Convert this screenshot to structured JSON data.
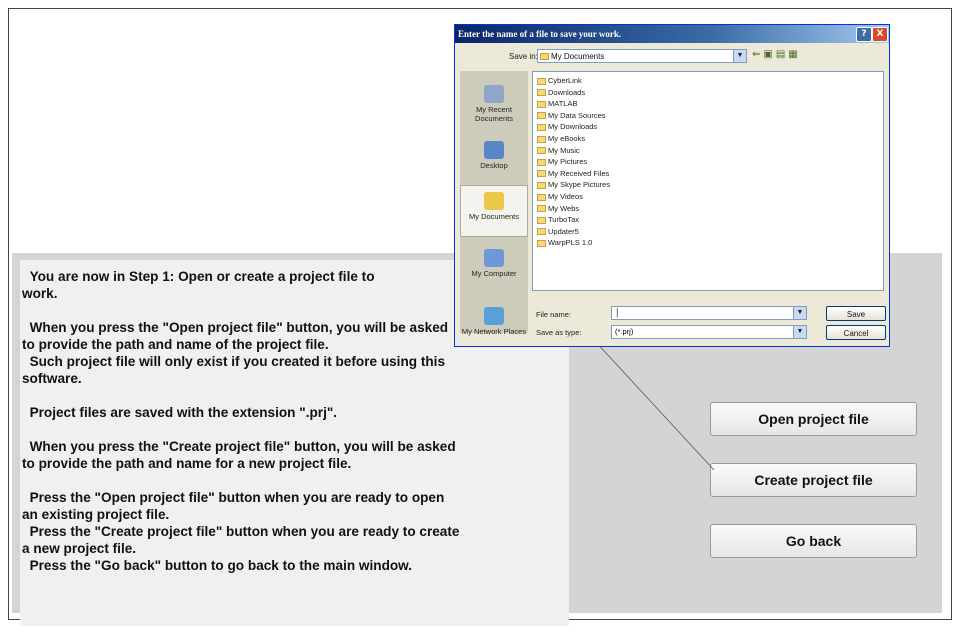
{
  "instructions": {
    "lines": [
      "  You are now in Step 1: Open or create a project file to",
      "work.",
      "",
      "  When you press the \"Open project file\" button, you will be asked",
      "to provide the path and name of the project file.",
      "  Such project file will only exist if you created it before using this",
      "software.",
      "",
      "  Project files are saved with the extension \".prj\".",
      "",
      "  When you press the \"Create project file\" button, you will be asked",
      "to provide the path and name for a new project file.",
      "",
      "  Press the \"Open project file\" button when you are ready to open",
      "an existing project file.",
      "  Press the \"Create project file\" button when you are ready to create",
      "a new project file.",
      "  Press the \"Go back\" button to go back to the main window."
    ]
  },
  "buttons": {
    "open": "Open project file",
    "create": "Create project file",
    "back": "Go back"
  },
  "dialog": {
    "title": "Enter the name of a file to save your work.",
    "save_in_label": "Save in:",
    "save_in_value": "My Documents",
    "places": [
      {
        "label": "My Recent Documents",
        "icon": "recent-documents-icon"
      },
      {
        "label": "Desktop",
        "icon": "desktop-icon"
      },
      {
        "label": "My Documents",
        "icon": "my-documents-icon"
      },
      {
        "label": "My Computer",
        "icon": "my-computer-icon"
      },
      {
        "label": "My Network Places",
        "icon": "network-places-icon"
      }
    ],
    "files": [
      "CyberLink",
      "Downloads",
      "MATLAB",
      "My Data Sources",
      "My Downloads",
      "My eBooks",
      "My Music",
      "My Pictures",
      "My Received Files",
      "My Skype Pictures",
      "My Videos",
      "My Webs",
      "TurboTax",
      "Updater5",
      "WarpPLS 1.0"
    ],
    "file_name_label": "File name:",
    "file_name_value": "",
    "save_as_type_label": "Save as type:",
    "save_as_type_value": "(*.prj)",
    "save_button": "Save",
    "cancel_button": "Cancel",
    "help_glyph": "?",
    "close_glyph": "X"
  },
  "colors": {
    "titlebar_start": "#0a246a",
    "dialog_bg": "#ece9d8",
    "panel_gray": "#d4d4d4"
  }
}
